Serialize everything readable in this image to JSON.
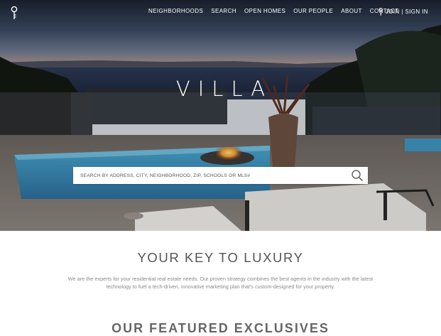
{
  "header": {
    "logo_icon": "key-icon",
    "nav": [
      "NEIGHBORHOODS",
      "SEARCH",
      "OPEN HOMES",
      "OUR PEOPLE",
      "ABOUT",
      "CONTACT"
    ],
    "join_label": "JOIN | SIGN IN",
    "join_icon": "key-icon"
  },
  "hero": {
    "wordmark": "VILLA",
    "search": {
      "placeholder": "SEARCH BY ADDRESS, CITY, NEIGHBORHOOD, ZIP, SCHOOLS OR MLS#",
      "icon": "search-icon"
    }
  },
  "main": {
    "tagline": "YOUR KEY TO LUXURY",
    "intro": "We are the experts for your residential real estate needs. Our proven strategy combines the best agents in the industry with the latest technology to fuel a tech-driven, innovative marketing plan that's custom-designed for your property.",
    "featured_title": "OUR FEATURED EXCLUSIVES"
  },
  "colors": {
    "nav_text": "#ffffff",
    "heading_text": "#555555",
    "body_text": "#8a8a8a",
    "background": "#ffffff"
  }
}
